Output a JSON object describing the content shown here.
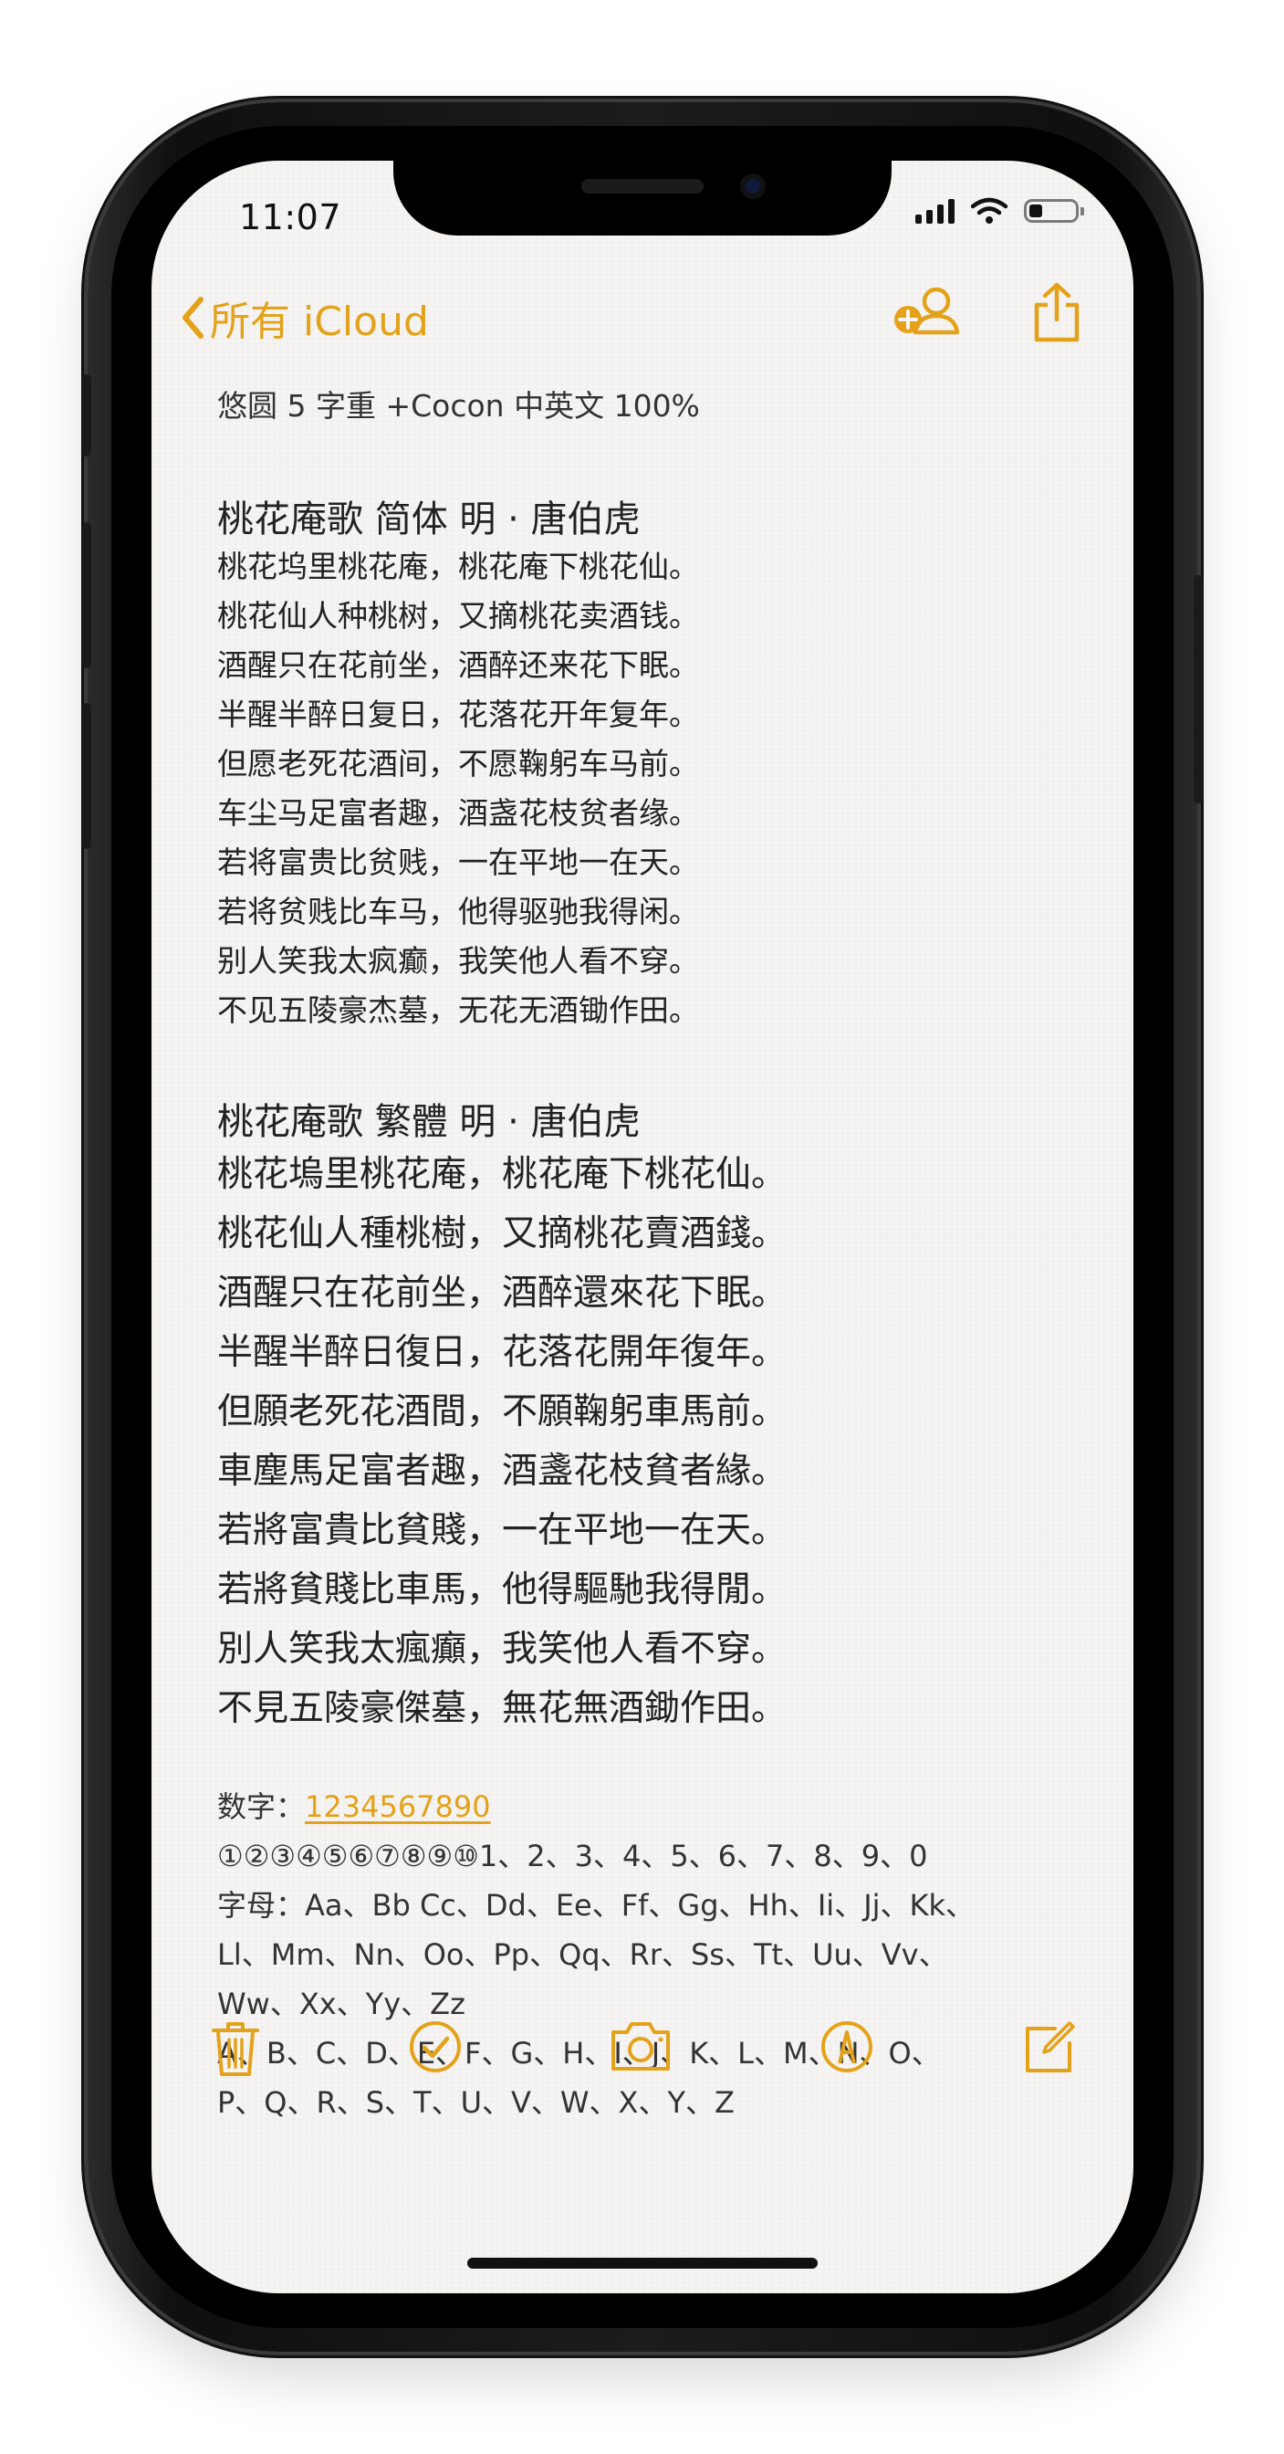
{
  "status": {
    "time": "11:07"
  },
  "nav": {
    "back_label": "所有 iCloud"
  },
  "note": {
    "subtitle": "悠圆 5 字重 +Cocon 中英文 100%",
    "simplified": {
      "title": "桃花庵歌  简体   明 · 唐伯虎",
      "lines": [
        "桃花坞里桃花庵，桃花庵下桃花仙。",
        "桃花仙人种桃树，又摘桃花卖酒钱。",
        "酒醒只在花前坐，酒醉还来花下眠。",
        "半醒半醉日复日，花落花开年复年。",
        "但愿老死花酒间，不愿鞠躬车马前。",
        "车尘马足富者趣，酒盏花枝贫者缘。",
        "若将富贵比贫贱，一在平地一在天。",
        "若将贫贱比车马，他得驱驰我得闲。",
        "别人笑我太疯癫，我笑他人看不穿。",
        "不见五陵豪杰墓，无花无酒锄作田。"
      ]
    },
    "traditional": {
      "title": "桃花庵歌  繁體    明 · 唐伯虎",
      "lines": [
        "桃花塢里桃花庵，桃花庵下桃花仙。",
        "桃花仙人種桃樹，又摘桃花賣酒錢。",
        "酒醒只在花前坐，酒醉還來花下眠。",
        "半醒半醉日復日，花落花開年復年。",
        "但願老死花酒間，不願鞠躬車馬前。",
        "車塵馬足富者趣，酒盞花枝貧者緣。",
        "若將富貴比貧賤，一在平地一在天。",
        "若將貧賤比車馬，他得驅馳我得閒。",
        "別人笑我太瘋癲，我笑他人看不穿。",
        "不見五陵豪傑墓，無花無酒鋤作田。"
      ]
    },
    "digits_label": "数字：",
    "digits_link": "1234567890",
    "misc_lines": [
      "①②③④⑤⑥⑦⑧⑨⑩1、2、3、4、5、6、7、8、9、0",
      "字母：Aa、Bb Cc、Dd、Ee、Ff、Gg、Hh、Ii、Jj、Kk、",
      "Ll、Mm、Nn、Oo、Pp、Qq、Rr、Ss、Tt、Uu、Vv、",
      "Ww、Xx、Yy、Zz",
      "A、B、C、D、E、F、G、H、I、J、K、L、M、N、O、",
      "P、Q、R、S、T、U、V、W、X、Y、Z"
    ]
  },
  "theme": {
    "accent": "#e3a21a",
    "paper": "#f6f5f3"
  }
}
